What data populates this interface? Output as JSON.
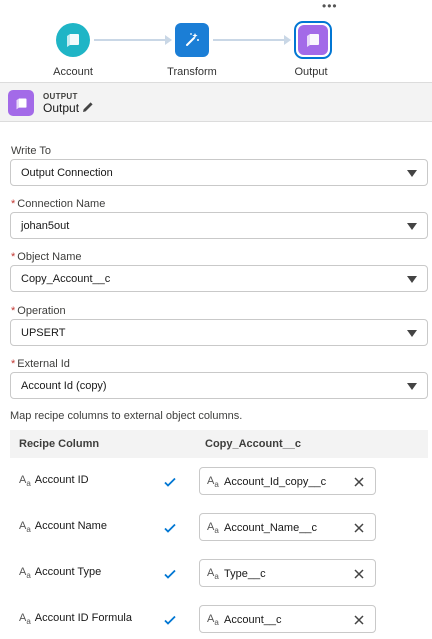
{
  "flow": {
    "more_glyph": "•••",
    "nodes": [
      {
        "label": "Account",
        "icon": "dataset-icon",
        "color": "#1fb5c6"
      },
      {
        "label": "Transform",
        "icon": "magic-wand-icon",
        "color": "#1b7ed6"
      },
      {
        "label": "Output",
        "icon": "output-icon",
        "color": "#a36ae8"
      }
    ]
  },
  "panel": {
    "type_label": "OUTPUT",
    "name": "Output"
  },
  "form": {
    "write_to": {
      "label": "Write To",
      "value": "Output Connection"
    },
    "connection_name": {
      "label": "Connection Name",
      "value": "johan5out",
      "required": true
    },
    "object_name": {
      "label": "Object Name",
      "value": "Copy_Account__c",
      "required": true
    },
    "operation": {
      "label": "Operation",
      "value": "UPSERT",
      "required": true
    },
    "external_id": {
      "label": "External Id",
      "value": "Account Id (copy)",
      "required": true
    },
    "required_marker": "*"
  },
  "mapping": {
    "hint": "Map recipe columns to external object columns.",
    "headers": {
      "recipe_column": "Recipe Column",
      "target_column": "Copy_Account__c"
    },
    "type_glyph": {
      "big": "A",
      "small": "a"
    },
    "rows": [
      {
        "source": "Account ID",
        "target": "Account_Id_copy__c"
      },
      {
        "source": "Account Name",
        "target": "Account_Name__c"
      },
      {
        "source": "Account Type",
        "target": "Type__c"
      },
      {
        "source": "Account ID Formula",
        "target": "Account__c"
      }
    ]
  },
  "colors": {
    "accent": "#0176d3",
    "required": "#c23934"
  }
}
